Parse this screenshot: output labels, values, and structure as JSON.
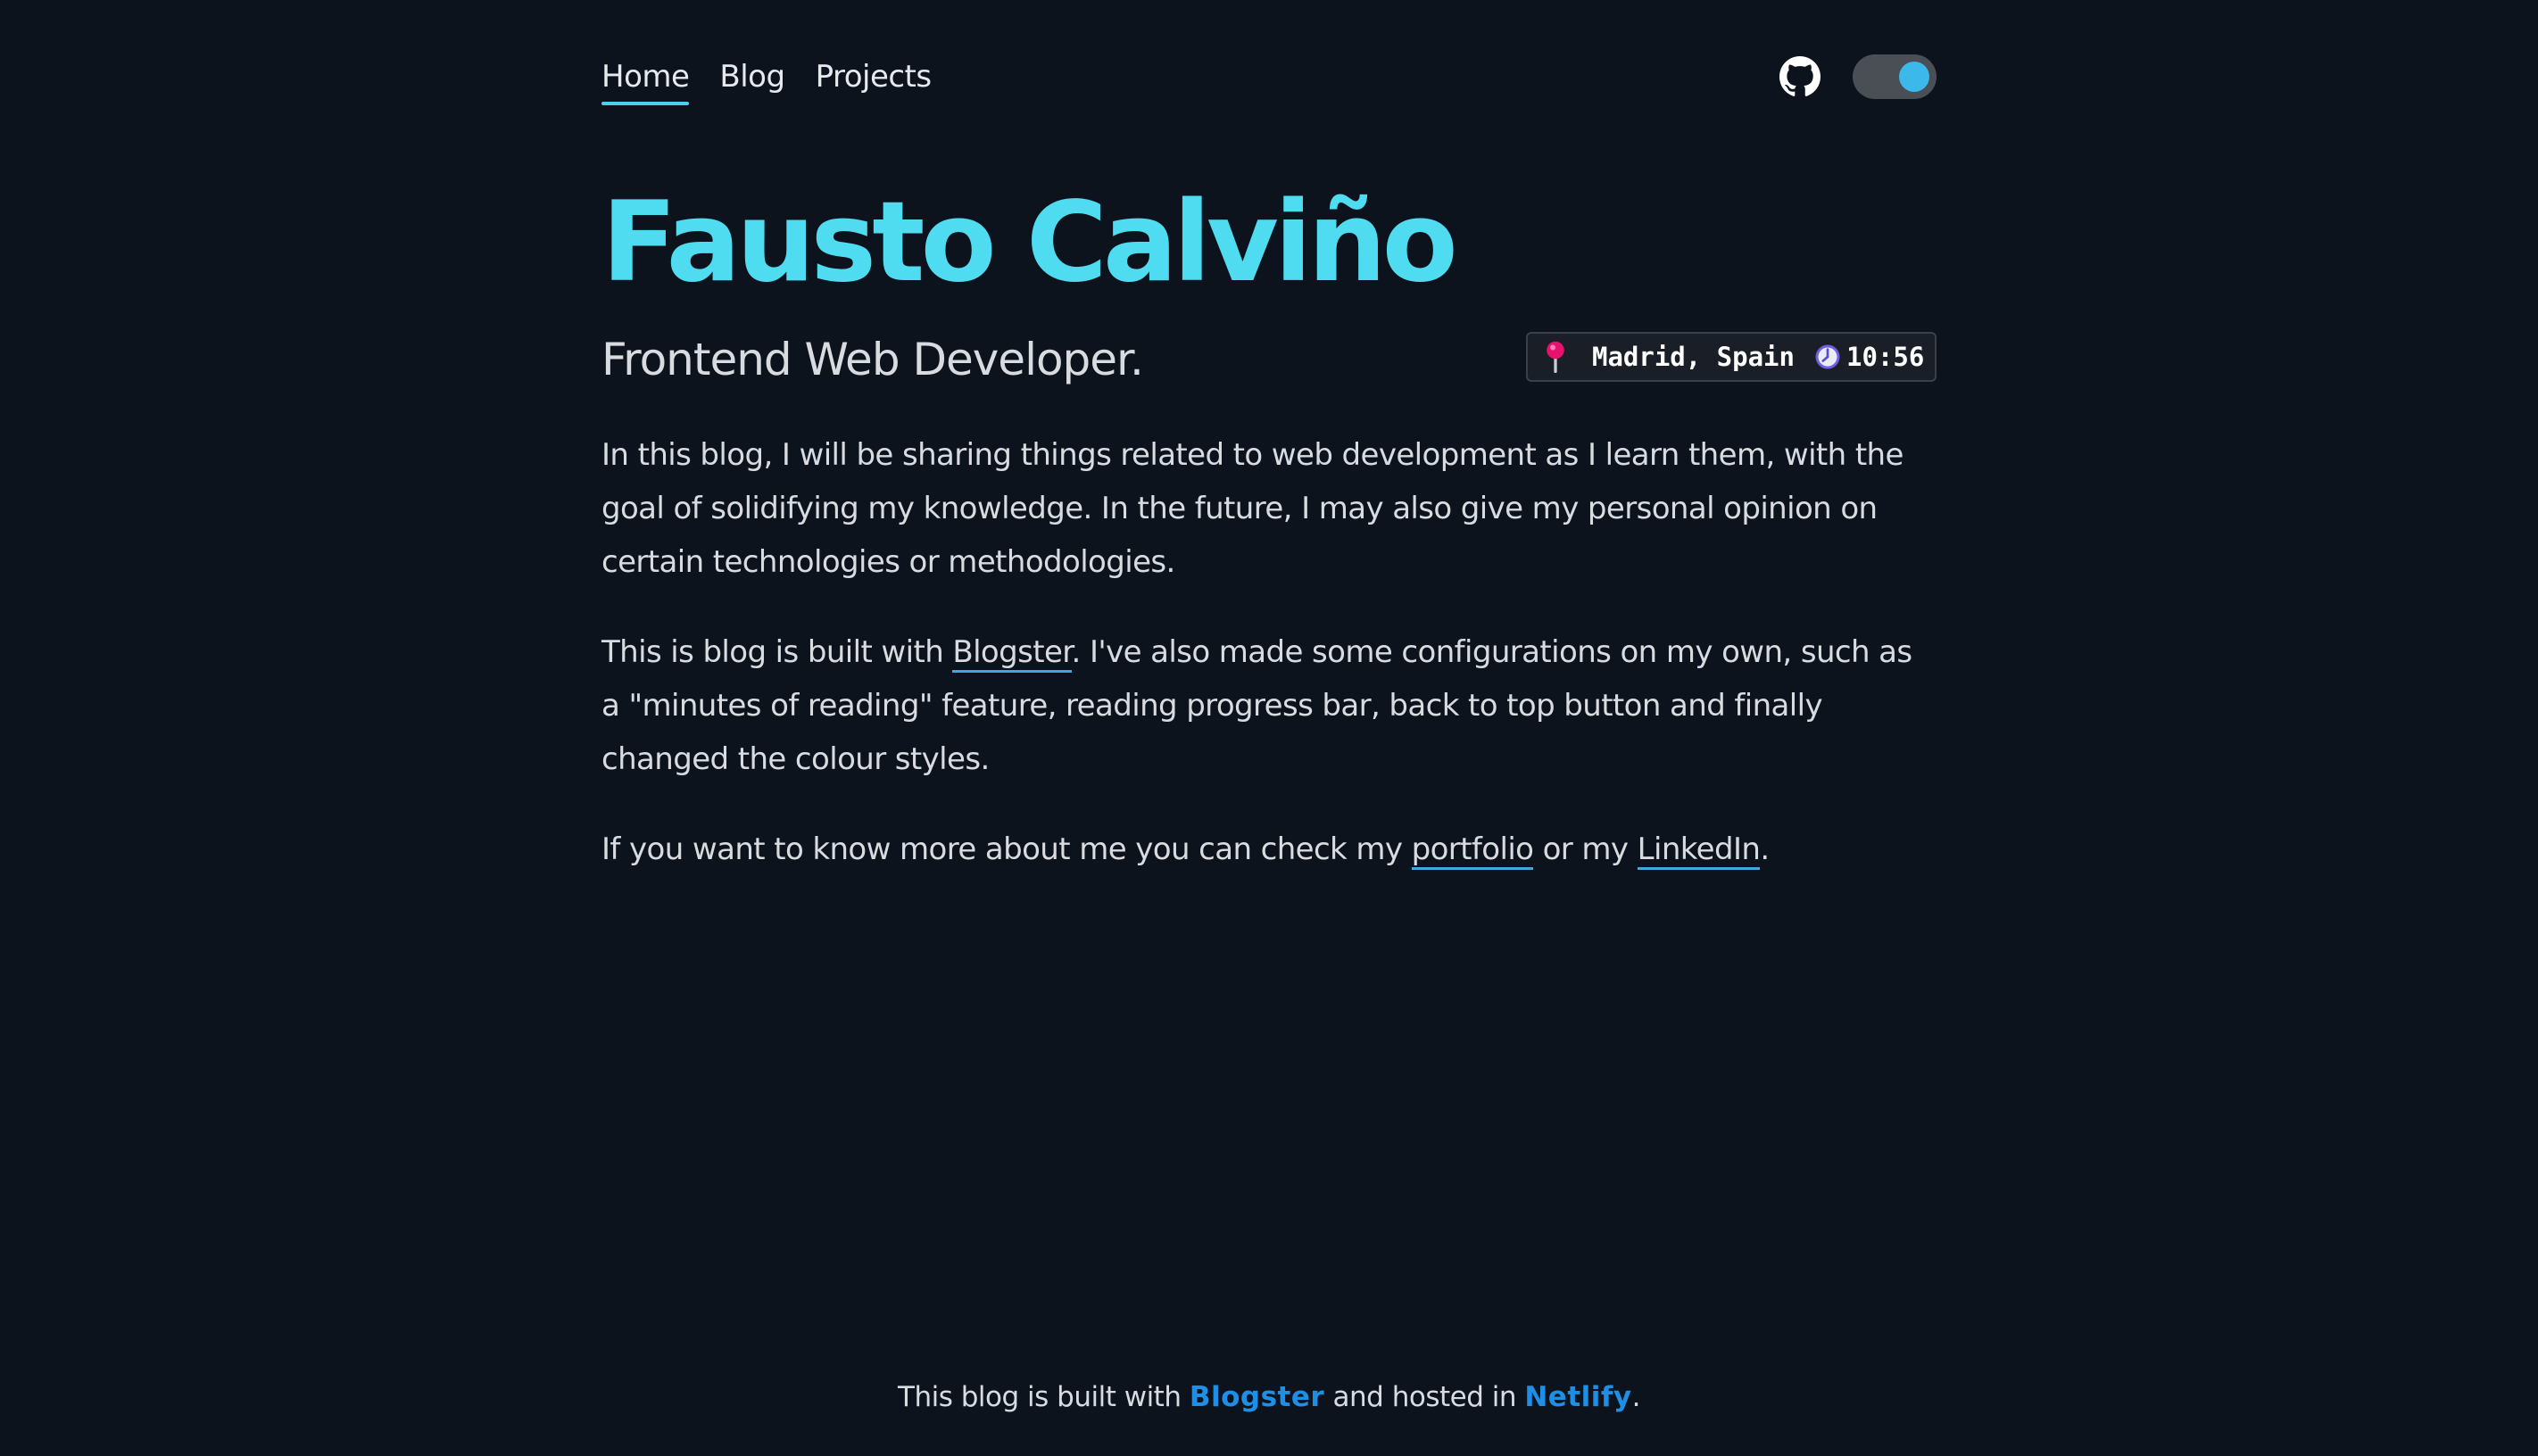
{
  "nav": {
    "links": [
      {
        "label": "Home",
        "active": true
      },
      {
        "label": "Blog",
        "active": false
      },
      {
        "label": "Projects",
        "active": false
      }
    ],
    "github_icon": "github-icon",
    "theme_toggle_state": "dark"
  },
  "hero": {
    "title": "Fausto Calviño",
    "subtitle": "Frontend Web Developer.",
    "location": {
      "pin_icon": "pin-icon",
      "place": "Madrid, Spain",
      "clock_icon": "clock-icon",
      "time": "10:56"
    }
  },
  "content": {
    "p1": "In this blog, I will be sharing things related to web development as I learn them, with the goal of solidifying my knowledge. In the future, I may also give my personal opinion on certain technologies or methodologies.",
    "p2_before": "This is blog is built with ",
    "p2_link": "Blogster",
    "p2_after": ". I've also made some configurations on my own, such as a \"minutes of reading\" feature, reading progress bar, back to top button and finally changed the colour styles.",
    "p3_before": "If you want to know more about me you can check my ",
    "p3_link1": "portfolio",
    "p3_mid": " or my ",
    "p3_link2": "LinkedIn",
    "p3_after": "."
  },
  "footer": {
    "before": "This blog is built with ",
    "link1": "Blogster",
    "mid": " and hosted in ",
    "link2": "Netlify",
    "after": "."
  },
  "colors": {
    "background": "#0d131c",
    "accent": "#4fdcf0",
    "footer_link": "#1d8fe6",
    "toggle_knob": "#3cb8ea"
  }
}
